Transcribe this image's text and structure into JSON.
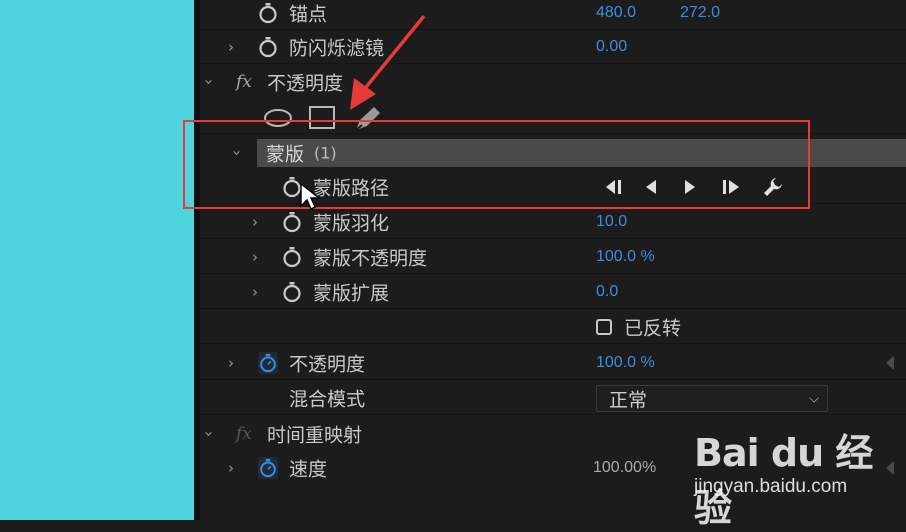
{
  "effects_panel": {
    "anchor_point": {
      "label": "锚点",
      "value_x": "480.0",
      "value_y": "272.0"
    },
    "anti_flicker": {
      "label": "防闪烁滤镜",
      "value": "0.00"
    },
    "opacity_effect": {
      "fx": "fx",
      "label": "不透明度"
    },
    "mask_tools": [
      "ellipse-mask-tool",
      "rectangle-mask-tool",
      "pen-mask-tool"
    ],
    "mask": {
      "title": "蒙版",
      "count": "(1)",
      "path": {
        "label": "蒙版路径"
      },
      "feather": {
        "label": "蒙版羽化",
        "value": "10.0"
      },
      "opacity": {
        "label": "蒙版不透明度",
        "value": "100.0 %"
      },
      "expansion": {
        "label": "蒙版扩展",
        "value": "0.0"
      },
      "inverted": {
        "label": "已反转",
        "checked": false
      }
    },
    "opacity": {
      "label": "不透明度",
      "value": "100.0 %"
    },
    "blend_mode": {
      "label": "混合模式",
      "selected": "正常"
    },
    "time_remap": {
      "fx": "fx",
      "label": "时间重映射"
    },
    "speed": {
      "label": "速度",
      "value": "100.00%"
    }
  },
  "watermark": {
    "brand": "Bai du 经验",
    "url": "jingyan.baidu.com"
  },
  "colors": {
    "accent_blue": "#3b8de0",
    "highlight_red": "#e53b3b",
    "panel_bg": "#1c1c1c",
    "side_cyan": "#4fd3dd"
  }
}
